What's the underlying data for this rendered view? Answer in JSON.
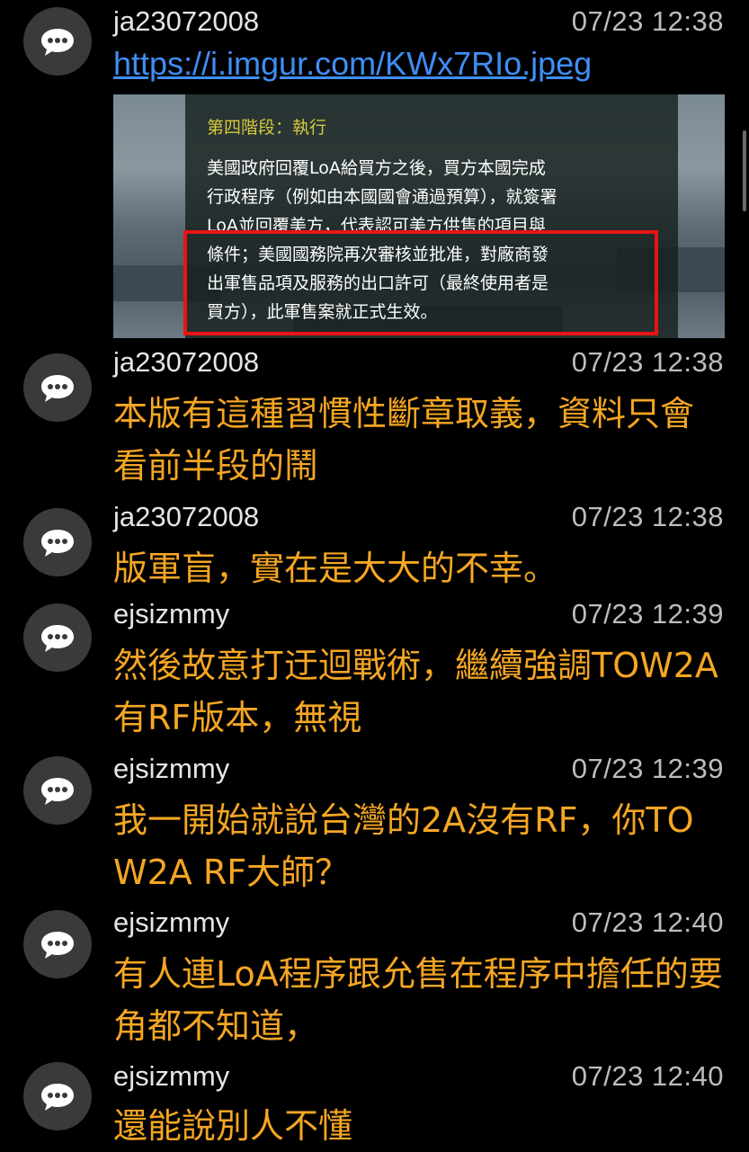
{
  "comments": [
    {
      "author": "ja23072008",
      "time": "07/23 12:38",
      "link": "https://i.imgur.com/KWx7RIo.jpeg",
      "image": {
        "heading": "第四階段：執行",
        "lines": [
          "美國政府回覆LoA給買方之後，買方本國完成",
          "行政程序（例如由本國國會通過預算），就簽署",
          "LoA並回覆美方，代表認可美方供售的項目與",
          "條件；美國國務院再次審核並批准，對廠商發",
          "出軍售品項及服務的出口許可（最終使用者是",
          "買方），此軍售案就正式生效。"
        ]
      }
    },
    {
      "author": "ja23072008",
      "time": "07/23 12:38",
      "text": "本版有這種習慣性斷章取義，資料只會看前半段的鬧"
    },
    {
      "author": "ja23072008",
      "time": "07/23 12:38",
      "text": "版軍盲，實在是大大的不幸。"
    },
    {
      "author": "ejsizmmy",
      "time": "07/23 12:39",
      "text": "然後故意打迂迴戰術，繼續強調TOW2A有RF版本，無視"
    },
    {
      "author": "ejsizmmy",
      "time": "07/23 12:39",
      "text": "我一開始就說台灣的2A沒有RF，你TOW2A RF大師？"
    },
    {
      "author": "ejsizmmy",
      "time": "07/23 12:40",
      "text": "有人連LoA程序跟允售在程序中擔任的要角都不知道，"
    },
    {
      "author": "ejsizmmy",
      "time": "07/23 12:40",
      "text": "還能說別人不懂"
    }
  ],
  "colors": {
    "text": "#f5a623",
    "author": "#e6e6e6",
    "time": "#bdbdbd",
    "link": "#3f8ef5",
    "avatar": "#3a3a3a",
    "highlight": "#e81414"
  },
  "icons": {
    "avatar": "chat-bubble-icon"
  }
}
